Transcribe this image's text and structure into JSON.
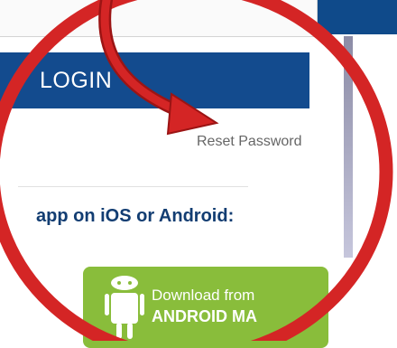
{
  "login": {
    "label": "LOGIN"
  },
  "reset": {
    "label": "Reset Password"
  },
  "app": {
    "text": "app on iOS or Android:"
  },
  "android": {
    "line1": "Download from",
    "line2": "ANDROID MA"
  },
  "colors": {
    "accent_red": "#d42525",
    "brand_blue": "#134b8e",
    "android_green": "#89bd3b"
  },
  "icons": [
    "android-icon",
    "curved-arrow-icon"
  ]
}
